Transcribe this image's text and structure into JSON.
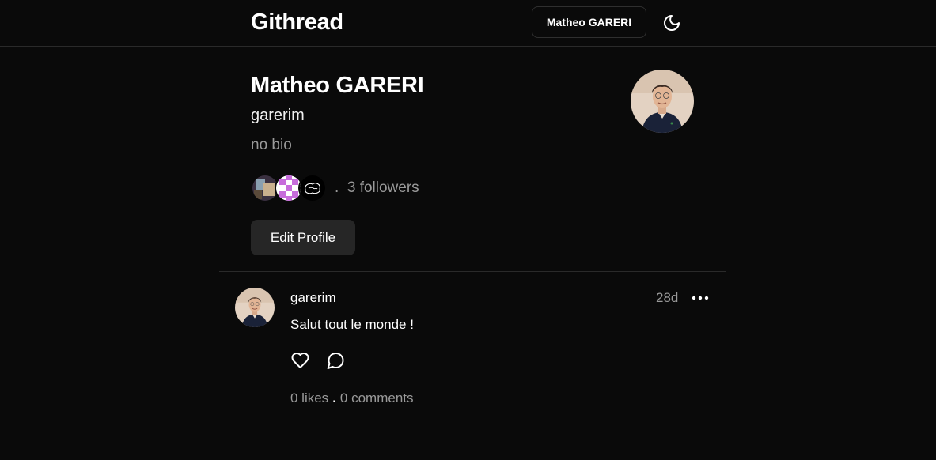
{
  "header": {
    "brand": "Githread",
    "user_button_label": "Matheo GARERI",
    "theme_icon": "moon-icon"
  },
  "profile": {
    "name": "Matheo GARERI",
    "username": "garerim",
    "bio": "no bio",
    "followers_separator": ".",
    "followers_text": "3 followers",
    "edit_button_label": "Edit Profile"
  },
  "post": {
    "author": "garerim",
    "time": "28d",
    "text": "Salut tout le monde !",
    "likes": "0 likes",
    "stats_separator": ".",
    "comments": "0 comments"
  },
  "colors": {
    "background": "#0a0a0a",
    "text": "#ffffff",
    "muted": "#9a9a9a",
    "button_bg": "#262626",
    "border": "#2a2a2a"
  }
}
